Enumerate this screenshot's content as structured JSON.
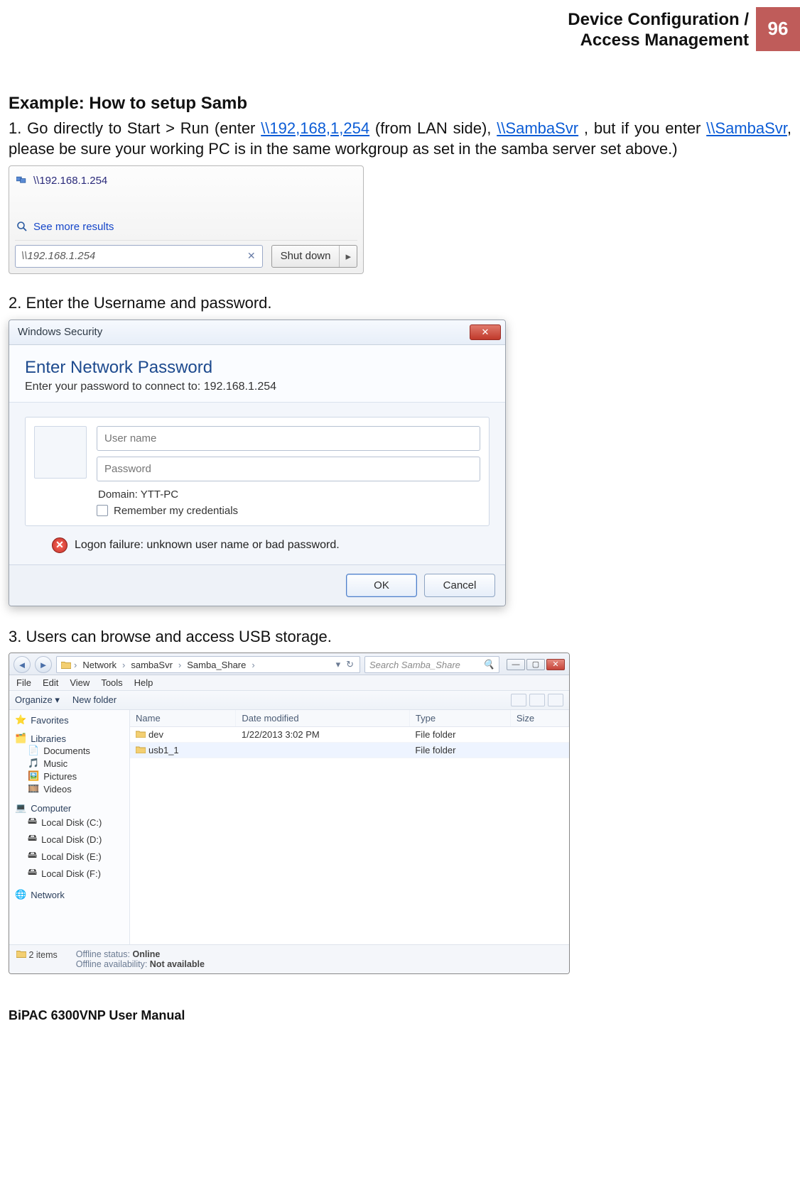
{
  "header": {
    "title": "Device Configuration /\nAccess Management",
    "page_number": "96"
  },
  "example_heading": "Example: How to setup Samb",
  "step1": {
    "prefix": "1. Go directly to Start > Run (enter ",
    "link_ip": "\\\\192,168,1,254",
    "mid1": " (from LAN side), ",
    "link_samba1": "\\\\SambaSvr",
    "mid2": " , but if you enter ",
    "link_samba2": "\\\\SambaSvr",
    "suffix": ", please be sure your working PC is in the same workgroup as set in the samba server set above.)"
  },
  "fig1": {
    "result_text": "\\\\192.168.1.254",
    "see_more": "See more results",
    "search_value": "\\\\192.168.1.254",
    "shutdown_label": "Shut down"
  },
  "step2": "2. Enter the Username and password.",
  "fig2": {
    "window_title": "Windows Security",
    "heading": "Enter Network Password",
    "subheading": "Enter your password to connect to: 192.168.1.254",
    "username_placeholder": "User name",
    "password_placeholder": "Password",
    "domain_line": "Domain: YTT-PC",
    "remember_label": "Remember my credentials",
    "error_text": "Logon failure: unknown user name or bad password.",
    "ok_label": "OK",
    "cancel_label": "Cancel"
  },
  "step3": "3. Users can browse and access USB storage.",
  "fig3": {
    "breadcrumb": [
      "Network",
      "sambaSvr",
      "Samba_Share"
    ],
    "search_placeholder": "Search Samba_Share",
    "menubar": [
      "File",
      "Edit",
      "View",
      "Tools",
      "Help"
    ],
    "toolbar": {
      "organize": "Organize ▾",
      "new_folder": "New folder"
    },
    "columns": [
      "Name",
      "Date modified",
      "Type",
      "Size"
    ],
    "rows": [
      {
        "name": "dev",
        "date": "1/22/2013 3:02 PM",
        "type": "File folder",
        "size": ""
      },
      {
        "name": "usb1_1",
        "date": "",
        "type": "File folder",
        "size": ""
      }
    ],
    "sidebar": {
      "favorites": "Favorites",
      "libraries": {
        "label": "Libraries",
        "items": [
          "Documents",
          "Music",
          "Pictures",
          "Videos"
        ]
      },
      "computer": {
        "label": "Computer",
        "items": [
          "Local Disk (C:)",
          "Local Disk (D:)",
          "Local Disk (E:)",
          "Local Disk (F:)"
        ]
      },
      "network": "Network"
    },
    "status": {
      "items_label": "2 items",
      "offline_status_label": "Offline status:",
      "offline_status_value": "Online",
      "offline_avail_label": "Offline availability:",
      "offline_avail_value": "Not available"
    }
  },
  "footer": "BiPAC 6300VNP User Manual"
}
